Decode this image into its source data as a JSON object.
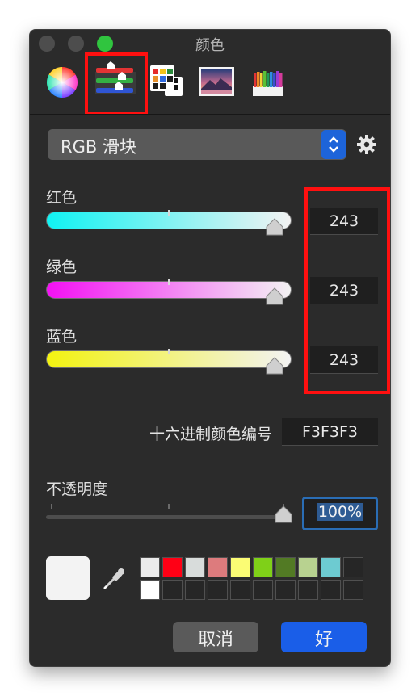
{
  "window": {
    "title": "颜色"
  },
  "toolbar": {
    "tools": [
      {
        "name": "color-wheel",
        "selected": false
      },
      {
        "name": "color-sliders",
        "selected": true
      },
      {
        "name": "color-palettes",
        "selected": false
      },
      {
        "name": "image-palettes",
        "selected": false
      },
      {
        "name": "pencils",
        "selected": false
      }
    ]
  },
  "mode_popup": {
    "label": "RGB 滑块"
  },
  "sliders": [
    {
      "label": "红色",
      "value": "243"
    },
    {
      "label": "绿色",
      "value": "243"
    },
    {
      "label": "蓝色",
      "value": "243"
    }
  ],
  "hex": {
    "label": "十六进制颜色编号",
    "value": "F3F3F3"
  },
  "opacity": {
    "label": "不透明度",
    "value": "100%"
  },
  "current_color": "#F3F3F3",
  "swatches": {
    "row1": [
      "#ebebeb",
      "#ff0015",
      "#d8dcdb",
      "#dd7b7d",
      "#fbfc74",
      "#7fd018",
      "#527a24",
      "#b8d290",
      "#6dcbd1",
      "#262626"
    ],
    "row2": [
      "#ffffff",
      "#262626",
      "#262626",
      "#262626",
      "#262626",
      "#262626",
      "#262626",
      "#262626",
      "#262626",
      "#262626"
    ]
  },
  "buttons": {
    "cancel": "取消",
    "ok": "好"
  }
}
